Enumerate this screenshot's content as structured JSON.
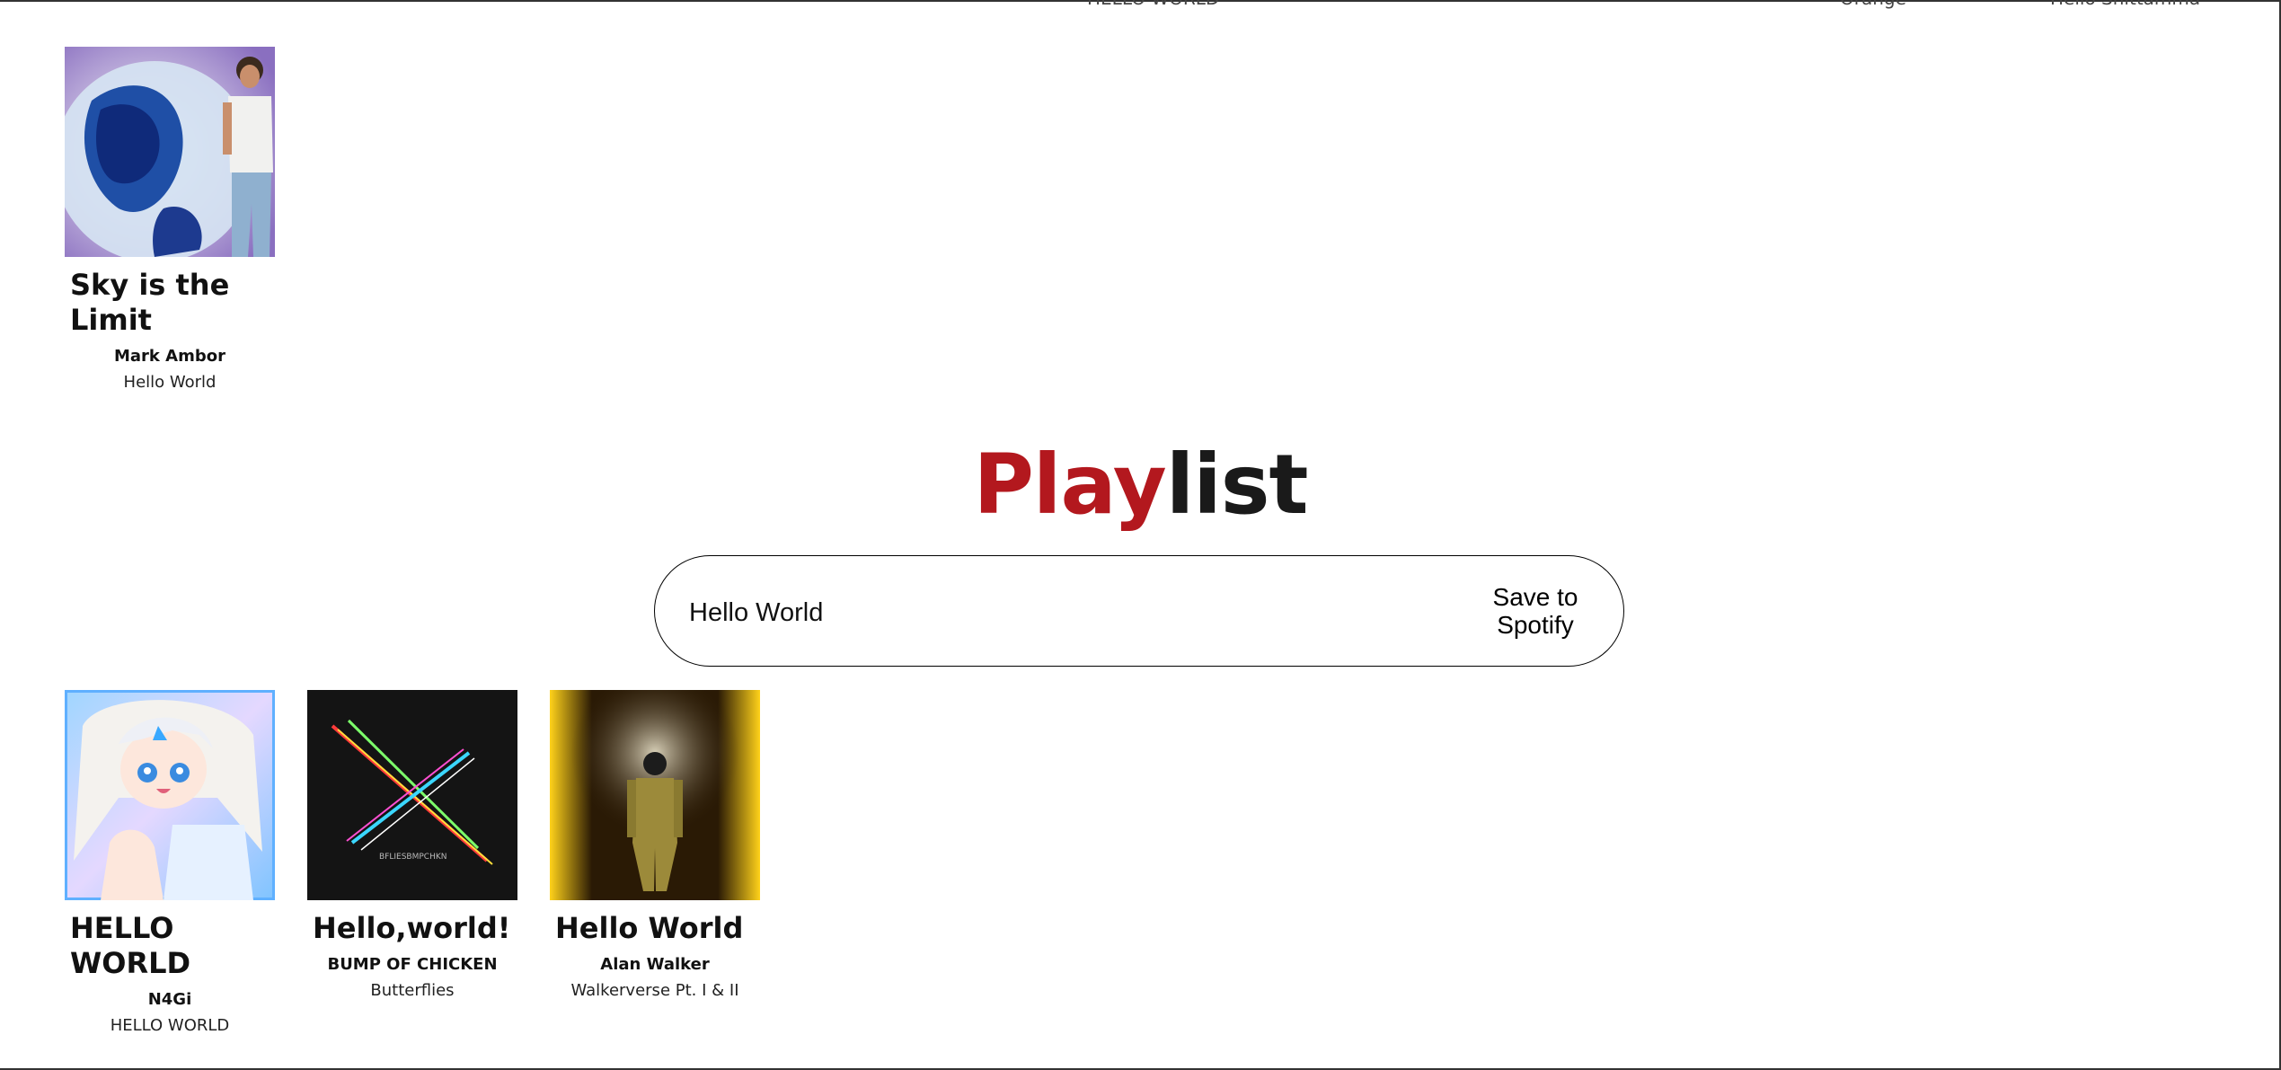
{
  "top_strip": {
    "a": "HELLO WORLD",
    "b": "Orange",
    "c": "Hello Shittamma"
  },
  "top_track": {
    "title": "Sky is the Limit",
    "artist": "Mark Ambor",
    "album": "Hello World"
  },
  "playlist": {
    "heading_accent": "Play",
    "heading_rest": "list",
    "name_value": "Hello World",
    "save_label": "Save to Spotify"
  },
  "tracks": [
    {
      "title": "HELLO WORLD",
      "artist": "N4Gi",
      "album": "HELLO WORLD"
    },
    {
      "title": "Hello,world!",
      "artist": "BUMP OF CHICKEN",
      "album": "Butterflies"
    },
    {
      "title": "Hello World",
      "artist": "Alan Walker",
      "album": "Walkerverse Pt. I & II"
    }
  ],
  "colors": {
    "accent": "#b3181e",
    "text": "#1a1a1a"
  },
  "icons": [
    "album-art-sky",
    "album-art-anime",
    "album-art-cross-lights",
    "album-art-tunnel"
  ]
}
